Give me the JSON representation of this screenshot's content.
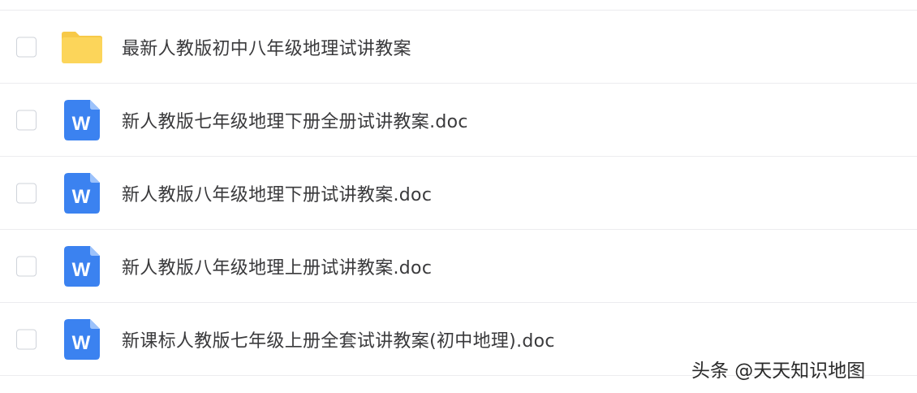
{
  "files": [
    {
      "type": "folder",
      "icon": "folder-icon",
      "name": "最新人教版初中八年级地理试讲教案"
    },
    {
      "type": "doc",
      "icon": "word-doc-icon",
      "icon_letter": "W",
      "name": "新人教版七年级地理下册全册试讲教案.doc"
    },
    {
      "type": "doc",
      "icon": "word-doc-icon",
      "icon_letter": "W",
      "name": "新人教版八年级地理下册试讲教案.doc"
    },
    {
      "type": "doc",
      "icon": "word-doc-icon",
      "icon_letter": "W",
      "name": "新人教版八年级地理上册试讲教案.doc"
    },
    {
      "type": "doc",
      "icon": "word-doc-icon",
      "icon_letter": "W",
      "name": "新课标人教版七年级上册全套试讲教案(初中地理).doc"
    }
  ],
  "watermark": "头条 @天天知识地图",
  "colors": {
    "folder": "#fcd55a",
    "folder_tab": "#f7c948",
    "word_blue": "#3b82f0",
    "word_fold": "#9cc2fb",
    "text": "#3a3a3c",
    "divider": "#ececef",
    "checkbox_border": "#cfd3da"
  }
}
